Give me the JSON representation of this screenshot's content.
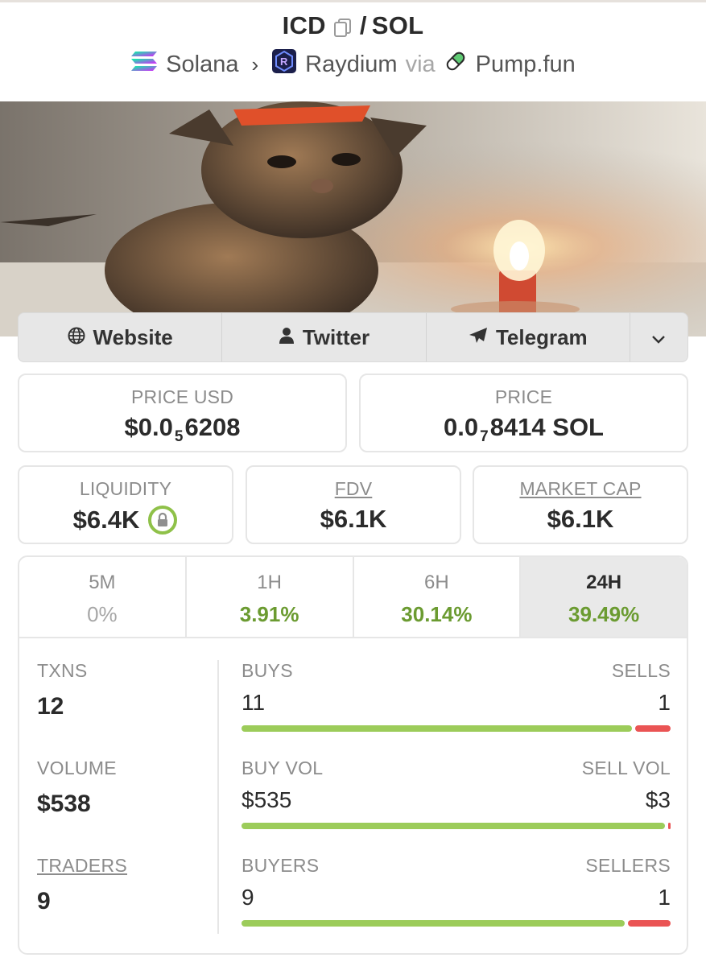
{
  "header": {
    "token": "ICD",
    "separator": "/",
    "quote": "SOL",
    "chain": "Solana",
    "dex": "Raydium",
    "via_word": "via",
    "launchpad": "Pump.fun"
  },
  "social": {
    "website": "Website",
    "twitter": "Twitter",
    "telegram": "Telegram"
  },
  "prices": {
    "price_usd_label": "PRICE USD",
    "price_usd_prefix": "$0.0",
    "price_usd_zeros": "5",
    "price_usd_digits": "6208",
    "price_label": "PRICE",
    "price_prefix": "0.0",
    "price_zeros": "7",
    "price_digits": "8414 SOL"
  },
  "metrics": {
    "liquidity_label": "LIQUIDITY",
    "liquidity_value": "$6.4K",
    "fdv_label": "FDV",
    "fdv_value": "$6.1K",
    "mcap_label": "MARKET CAP",
    "mcap_value": "$6.1K"
  },
  "tabs": [
    {
      "label": "5M",
      "change": "0%"
    },
    {
      "label": "1H",
      "change": "3.91%"
    },
    {
      "label": "6H",
      "change": "30.14%"
    },
    {
      "label": "24H",
      "change": "39.49%"
    }
  ],
  "active_tab": "24H",
  "stats": {
    "txns_label": "TXNS",
    "txns_value": "12",
    "volume_label": "VOLUME",
    "volume_value": "$538",
    "traders_label": "TRADERS",
    "traders_value": "9",
    "buys_label": "BUYS",
    "buys_value": "11",
    "sells_label": "SELLS",
    "sells_value": "1",
    "buy_vol_label": "BUY VOL",
    "buy_vol_value": "$535",
    "sell_vol_label": "SELL VOL",
    "sell_vol_value": "$3",
    "buyers_label": "BUYERS",
    "buyers_value": "9",
    "sellers_label": "SELLERS",
    "sellers_value": "1"
  },
  "bar_fractions": {
    "buys": 0.917,
    "buy_vol": 0.994,
    "buyers": 0.9
  },
  "colors": {
    "positive": "#6b9b31",
    "bar_buy": "#9ccc5a",
    "bar_sell": "#ea5454",
    "lock_ring": "#8fc149"
  }
}
